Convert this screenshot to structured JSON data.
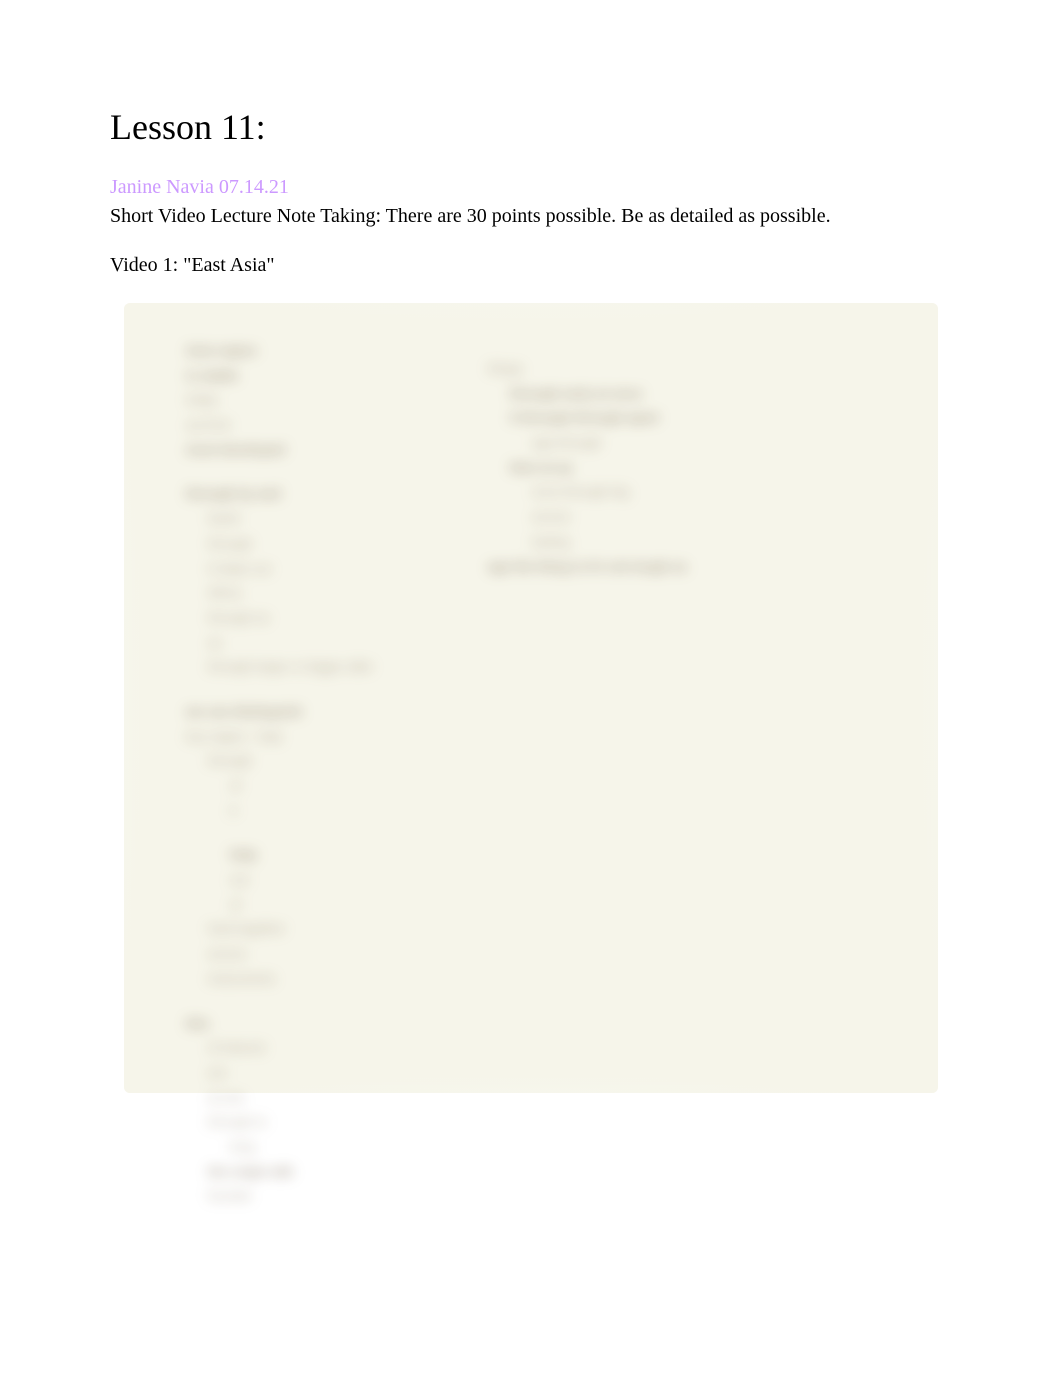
{
  "title": "Lesson 11:",
  "author_line": "Janine Navia 07.14.21",
  "instructions": "Short Video Lecture Note Taking: There are 30 points possible. Be as detailed as possible.",
  "video_label": "Video 1: \"East Asia\"",
  "notes": {
    "left": [
      {
        "text": "Asia region",
        "indent": 0,
        "strong": true
      },
      {
        "text": "is stable",
        "indent": 0,
        "strong": true
      },
      {
        "text": "today",
        "indent": 0,
        "strong": false
      },
      {
        "text": "up front",
        "indent": 0,
        "strong": false
      },
      {
        "text": "most developed",
        "indent": 0,
        "strong": true
      },
      {
        "text": "",
        "indent": 0,
        "blank": true
      },
      {
        "text": "through by and",
        "indent": 0,
        "strong": true
      },
      {
        "text": "North",
        "indent": 1,
        "strong": false
      },
      {
        "text": "through",
        "indent": 1,
        "strong": false
      },
      {
        "text": "it helps out",
        "indent": 1,
        "strong": false
      },
      {
        "text": "Africa",
        "indent": 1,
        "strong": false
      },
      {
        "text": "through as",
        "indent": 1,
        "strong": false
      },
      {
        "text": "as",
        "indent": 1,
        "strong": false
      },
      {
        "text": "through larger or bigger after",
        "indent": 1,
        "strong": false
      },
      {
        "text": "",
        "indent": 0,
        "blank": true
      },
      {
        "text": "we can distinguish",
        "indent": 0,
        "strong": true
      },
      {
        "text": "tiny region - help",
        "indent": 0,
        "strong": false
      },
      {
        "text": "through",
        "indent": 1,
        "strong": false
      },
      {
        "text": "of",
        "indent": 2,
        "strong": false
      },
      {
        "text": "it",
        "indent": 2,
        "strong": false
      },
      {
        "text": "",
        "indent": 0,
        "blank": true
      },
      {
        "text": "help",
        "indent": 2,
        "strong": true
      },
      {
        "text": "out",
        "indent": 2,
        "strong": false
      },
      {
        "text": "of",
        "indent": 2,
        "strong": false
      },
      {
        "text": "hard together",
        "indent": 1,
        "strong": false
      },
      {
        "text": "across",
        "indent": 1,
        "strong": false
      },
      {
        "text": "instruments",
        "indent": 1,
        "strong": false
      },
      {
        "text": "",
        "indent": 0,
        "blank": true
      },
      {
        "text": "this",
        "indent": 0,
        "strong": true
      },
      {
        "text": "of interest",
        "indent": 1,
        "strong": false
      },
      {
        "text": "are",
        "indent": 1,
        "strong": false
      },
      {
        "text": "at one",
        "indent": 1,
        "strong": false
      },
      {
        "text": "through to",
        "indent": 1,
        "strong": false
      },
      {
        "text": "long",
        "indent": 2,
        "strong": false
      },
      {
        "text": "the origin talk",
        "indent": 1,
        "strong": true
      },
      {
        "text": "founder",
        "indent": 1,
        "strong": false
      }
    ],
    "right": [
      {
        "text": "things",
        "indent": 0,
        "strong": false
      },
      {
        "text": "through early at once",
        "indent": 1,
        "strong": true
      },
      {
        "text": "it through through apart",
        "indent": 1,
        "strong": true
      },
      {
        "text": "age through",
        "indent": 2,
        "strong": false
      },
      {
        "text": "then at up",
        "indent": 1,
        "strong": true
      },
      {
        "text": "once through big",
        "indent": 2,
        "strong": false
      },
      {
        "text": "across",
        "indent": 2,
        "strong": false
      },
      {
        "text": "lasting",
        "indent": 2,
        "strong": false
      },
      {
        "text": "age the thing is it's not tough as",
        "indent": 0,
        "strong": true
      }
    ]
  }
}
